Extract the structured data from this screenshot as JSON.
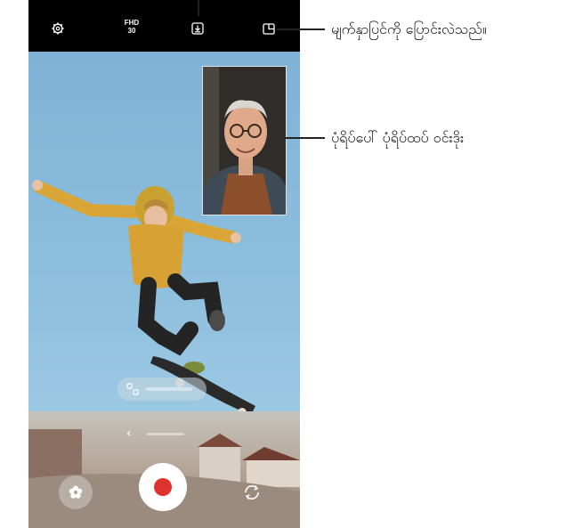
{
  "topbar": {
    "settings_icon": "gear-icon",
    "resolution_label": "FHD",
    "fps_label": "30",
    "download_icon": "download-icon",
    "layout_icon": "layout-icon"
  },
  "callouts": {
    "change_screen": "မျက်နှာပြင်ကို ပြောင်းလဲသည်။",
    "pip_window": "ပုံရိပ်ပေါ် ပုံရိပ်ထပ် ဝင်းဒိုး"
  },
  "controls": {
    "effects_icon": "flower-icon",
    "record_icon": "record-icon",
    "switch_camera_icon": "switch-camera-icon",
    "back_chevron": "‹"
  },
  "colors": {
    "record": "#e0322c",
    "topbar": "#000000",
    "sky": "#8cbedd"
  }
}
